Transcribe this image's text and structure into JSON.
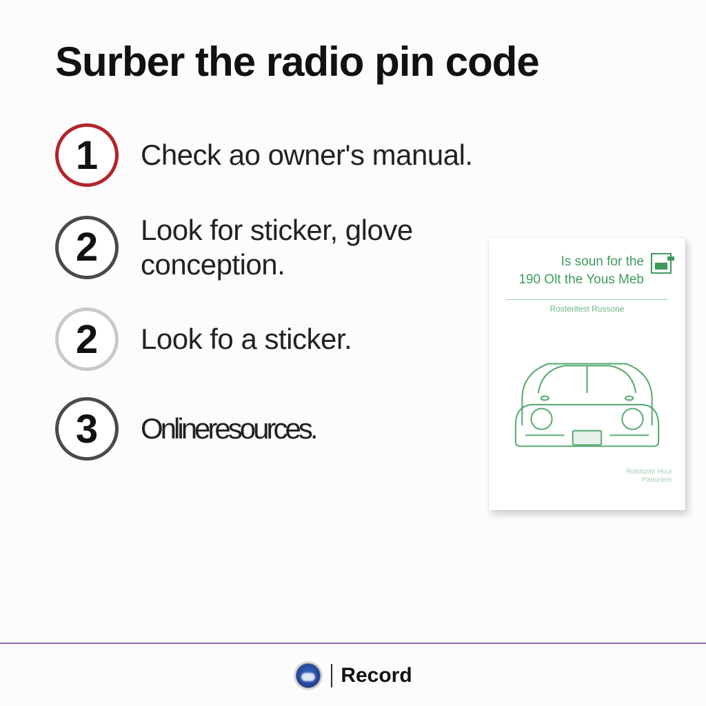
{
  "title": "Surber the radio pin code",
  "steps": [
    {
      "num": "1",
      "style": "red",
      "text": "Check ao owner's manual."
    },
    {
      "num": "2",
      "style": "dark",
      "text": "Look for sticker, glove conception."
    },
    {
      "num": "2",
      "style": "light",
      "text": "Look fo a sticker."
    },
    {
      "num": "3",
      "style": "dark",
      "text": "Onlineresources."
    }
  ],
  "card": {
    "line1": "Is soun for the",
    "line2": "190 Olt the Yous Meb",
    "subtitle": "Rosteritest Russone",
    "footer1": "Rolstunte Houl",
    "footer2": "Parlorteni"
  },
  "footer": {
    "brand": "Record"
  }
}
